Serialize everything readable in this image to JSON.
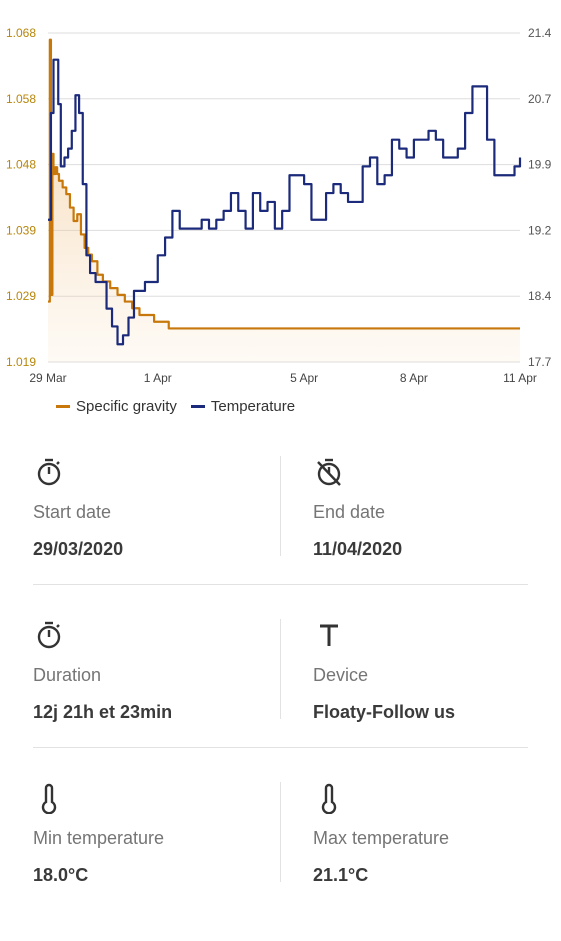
{
  "chart_data": {
    "type": "line",
    "x_ticks": [
      "29 Mar",
      "1 Apr",
      "5 Apr",
      "8 Apr",
      "11 Apr"
    ],
    "x_range_days": [
      0,
      12.9
    ],
    "x_tick_days": [
      0,
      3,
      7,
      10,
      12.9
    ],
    "y_left": {
      "label": "Specific gravity",
      "ticks": [
        "1.068",
        "1.058",
        "1.048",
        "1.039",
        "1.029",
        "1.019"
      ],
      "ylim": [
        1.019,
        1.068
      ]
    },
    "y_right": {
      "label": "Temperature",
      "ticks": [
        "21.4",
        "20.7",
        "19.9",
        "19.2",
        "18.4",
        "17.7"
      ],
      "ylim": [
        17.7,
        21.4
      ]
    },
    "grid": true,
    "legend_placement": "bottom-left",
    "series": [
      {
        "name": "Specific gravity",
        "color": "#c8780a",
        "axis": "left",
        "fill": true,
        "x": [
          0.0,
          0.05,
          0.08,
          0.12,
          0.15,
          0.2,
          0.25,
          0.3,
          0.35,
          0.4,
          0.5,
          0.6,
          0.7,
          0.8,
          0.9,
          1.0,
          1.1,
          1.2,
          1.35,
          1.5,
          1.7,
          1.9,
          2.1,
          2.3,
          2.5,
          2.7,
          2.9,
          3.1,
          3.3,
          3.6,
          4.0,
          5.0,
          6.0,
          7.0,
          8.0,
          9.0,
          10.0,
          11.0,
          12.0,
          12.9
        ],
        "y": [
          1.028,
          1.067,
          1.029,
          1.05,
          1.047,
          1.048,
          1.047,
          1.046,
          1.046,
          1.045,
          1.044,
          1.042,
          1.04,
          1.041,
          1.038,
          1.036,
          1.035,
          1.034,
          1.032,
          1.031,
          1.03,
          1.029,
          1.028,
          1.027,
          1.026,
          1.026,
          1.025,
          1.025,
          1.024,
          1.024,
          1.024,
          1.024,
          1.024,
          1.024,
          1.024,
          1.024,
          1.024,
          1.024,
          1.024,
          1.024
        ]
      },
      {
        "name": "Temperature",
        "color": "#1b2a7a",
        "axis": "right",
        "fill": false,
        "x": [
          0.0,
          0.08,
          0.15,
          0.2,
          0.28,
          0.35,
          0.45,
          0.55,
          0.65,
          0.75,
          0.85,
          0.95,
          1.05,
          1.15,
          1.3,
          1.45,
          1.6,
          1.75,
          1.9,
          2.05,
          2.2,
          2.35,
          2.5,
          2.65,
          2.8,
          3.0,
          3.2,
          3.4,
          3.6,
          3.8,
          4.0,
          4.2,
          4.4,
          4.6,
          4.8,
          5.0,
          5.2,
          5.4,
          5.6,
          5.8,
          6.0,
          6.2,
          6.4,
          6.6,
          6.8,
          7.0,
          7.2,
          7.4,
          7.6,
          7.8,
          8.0,
          8.2,
          8.4,
          8.6,
          8.8,
          9.0,
          9.2,
          9.4,
          9.6,
          9.8,
          10.0,
          10.2,
          10.4,
          10.6,
          10.8,
          11.0,
          11.2,
          11.4,
          11.6,
          11.8,
          12.0,
          12.2,
          12.4,
          12.6,
          12.75,
          12.9
        ],
        "y": [
          19.3,
          20.5,
          21.1,
          21.1,
          20.6,
          19.9,
          20.0,
          20.1,
          20.3,
          20.7,
          20.5,
          19.7,
          18.9,
          18.7,
          18.6,
          18.6,
          18.3,
          18.1,
          17.9,
          18.0,
          18.2,
          18.5,
          18.5,
          18.6,
          18.6,
          18.9,
          19.1,
          19.4,
          19.2,
          19.2,
          19.2,
          19.3,
          19.2,
          19.3,
          19.4,
          19.6,
          19.4,
          19.2,
          19.6,
          19.4,
          19.5,
          19.2,
          19.4,
          19.8,
          19.8,
          19.7,
          19.3,
          19.3,
          19.6,
          19.7,
          19.6,
          19.5,
          19.5,
          19.9,
          20.0,
          19.7,
          19.8,
          20.2,
          20.1,
          20.0,
          20.2,
          20.2,
          20.3,
          20.2,
          20.0,
          20.0,
          20.1,
          20.5,
          20.8,
          20.8,
          20.2,
          19.8,
          19.8,
          19.8,
          19.9,
          20.0
        ]
      }
    ]
  },
  "stats": [
    {
      "left": {
        "icon": "stopwatch-icon",
        "label": "Start date",
        "value": "29/03/2020"
      },
      "right": {
        "icon": "stopwatch-off-icon",
        "label": "End date",
        "value": "11/04/2020"
      }
    },
    {
      "left": {
        "icon": "stopwatch-icon",
        "label": "Duration",
        "value": "12j 21h et 23min"
      },
      "right": {
        "icon": "device-t-icon",
        "label": "Device",
        "value": "Floaty-Follow us"
      }
    },
    {
      "left": {
        "icon": "thermometer-icon",
        "label": "Min temperature",
        "value": "18.0°C"
      },
      "right": {
        "icon": "thermometer-icon",
        "label": "Max temperature",
        "value": "21.1°C"
      }
    }
  ],
  "colors": {
    "gravity": "#c8780a",
    "temperature": "#1b2a7a",
    "grid": "#dddddd",
    "text": "#3a3a3a",
    "muted": "#757575"
  }
}
